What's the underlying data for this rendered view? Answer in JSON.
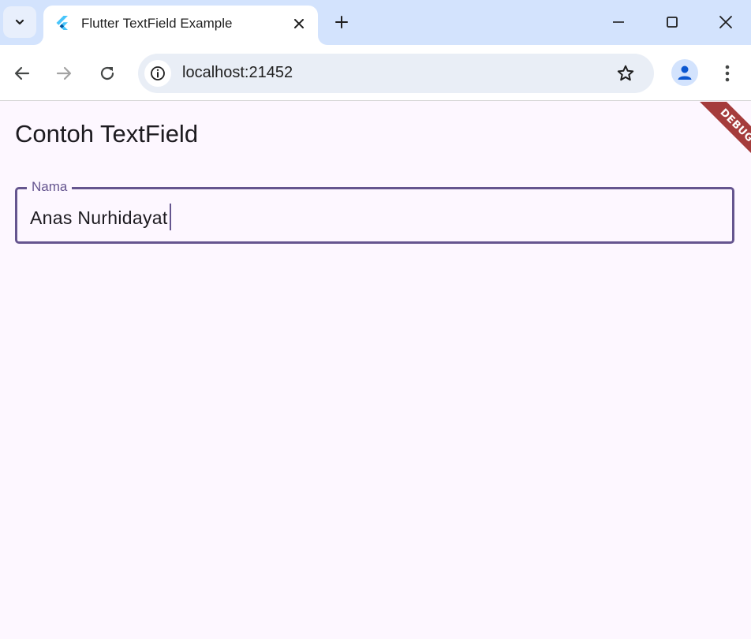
{
  "browser": {
    "tab": {
      "title": "Flutter TextField Example"
    },
    "address_bar": {
      "url": "localhost:21452"
    },
    "icons": {
      "tab_search": "chevron-down-icon",
      "tab_close": "close-icon",
      "new_tab": "plus-icon",
      "minimize": "minimize-icon",
      "maximize": "maximize-icon",
      "close_window": "close-icon",
      "back": "arrow-left-icon",
      "forward": "arrow-right-icon",
      "reload": "reload-icon",
      "site_info": "info-icon",
      "bookmark": "star-icon",
      "profile": "person-icon",
      "menu": "kebab-menu-icon"
    },
    "colors": {
      "tabstrip": "#d3e3fd",
      "omnibox": "#e9eef6"
    }
  },
  "app": {
    "title": "Contoh TextField",
    "debug_banner": "DEBUG",
    "text_field": {
      "label": "Nama",
      "value": "Anas Nurhidayat"
    },
    "colors": {
      "background": "#fdf7ff",
      "primary": "#65558f",
      "debug_banner": "#a53c3c"
    }
  }
}
